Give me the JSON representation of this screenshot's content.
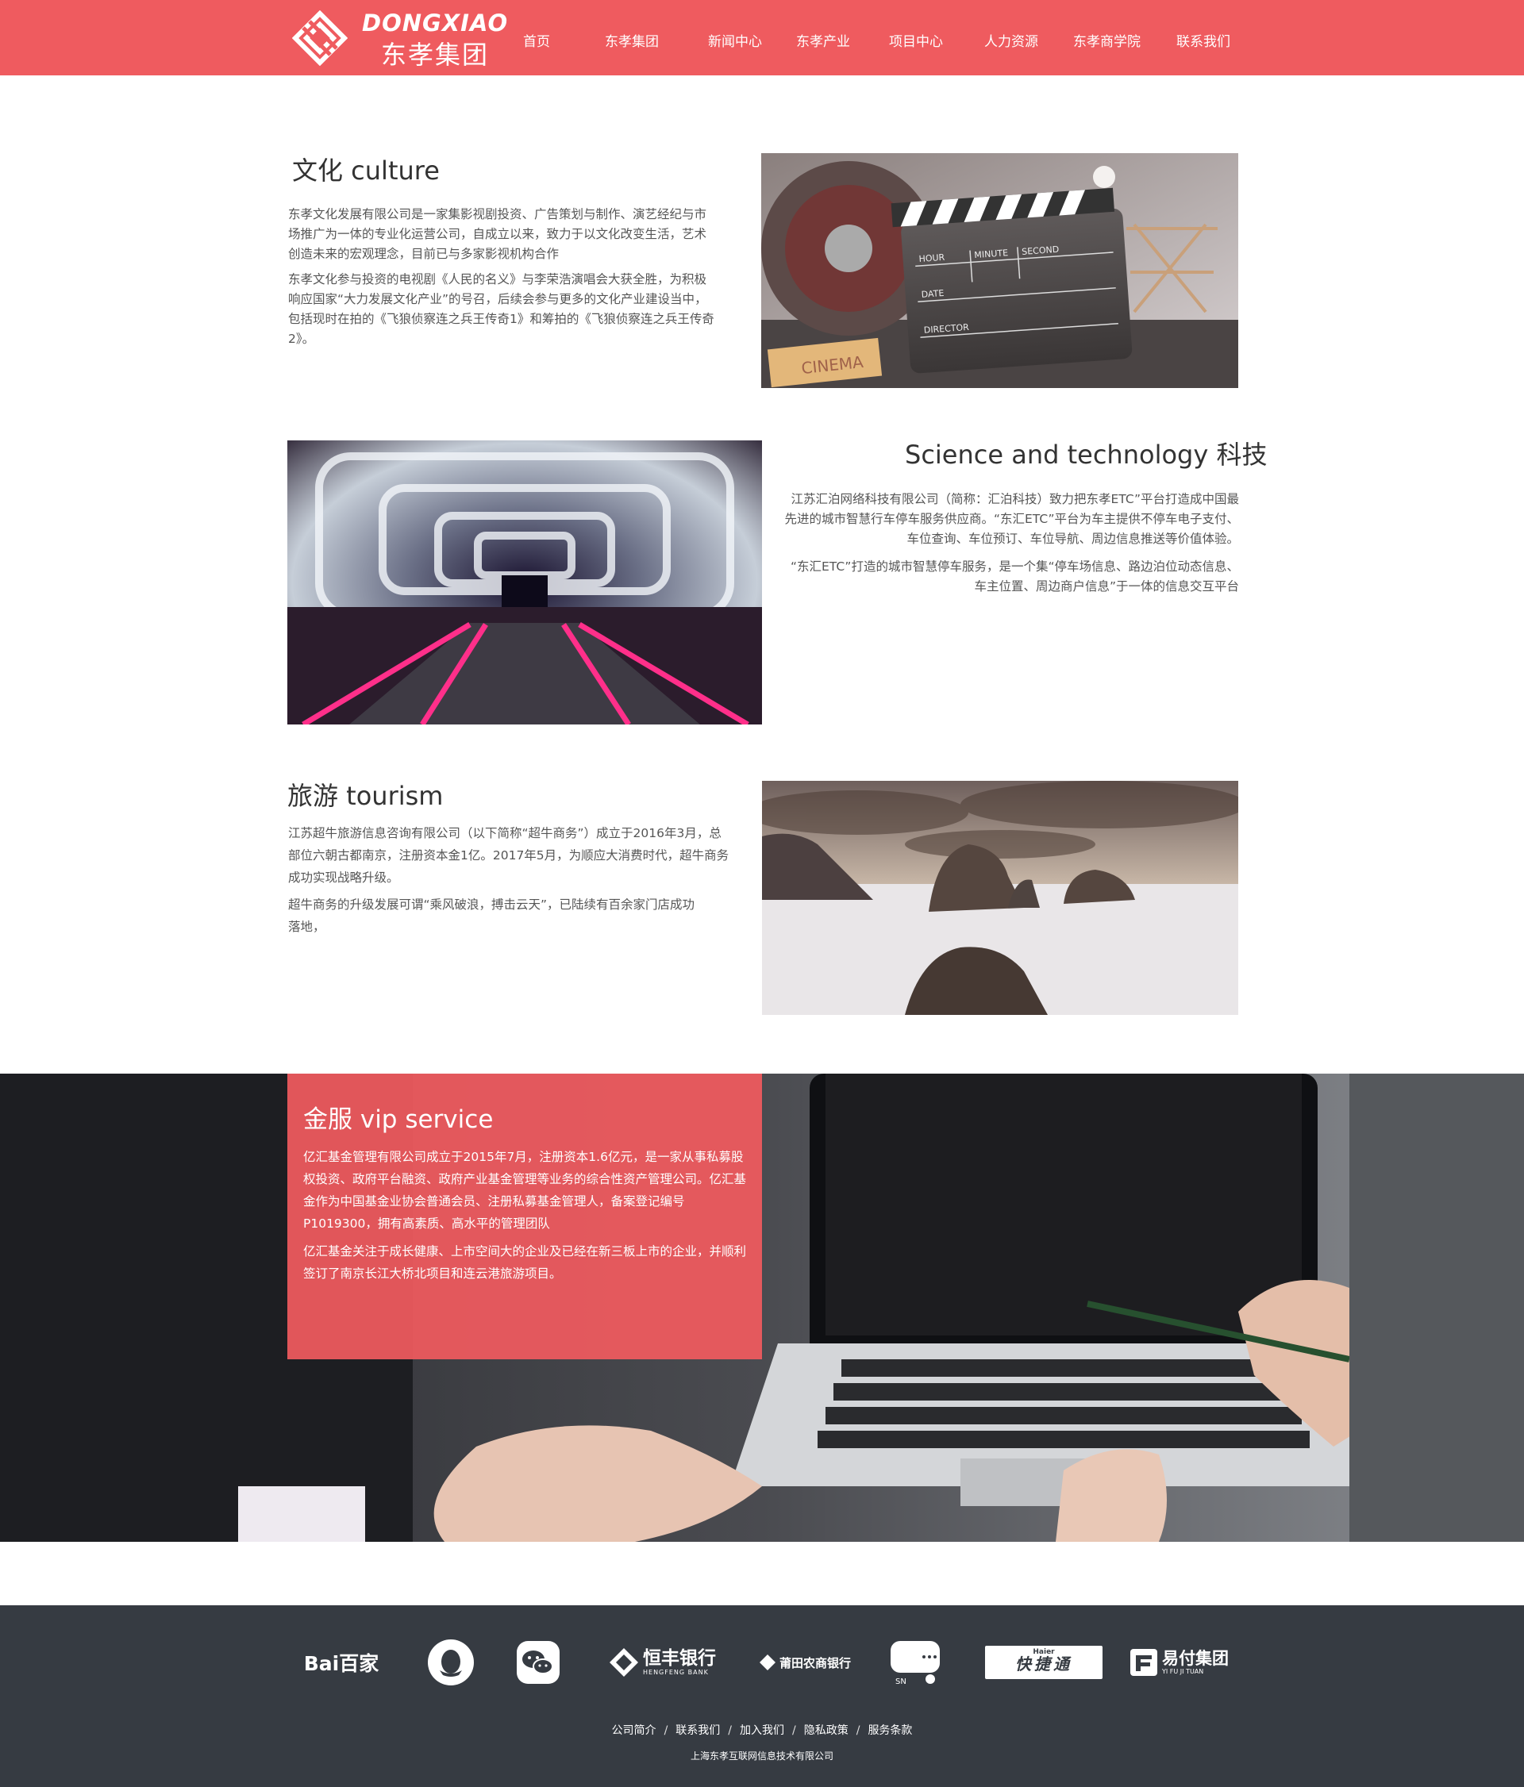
{
  "header": {
    "logo_en": "DONGXIAO",
    "logo_cn": "东孝集团",
    "nav": [
      {
        "label": "首页"
      },
      {
        "label": "东孝集团"
      },
      {
        "label": "新闻中心"
      },
      {
        "label": "东孝产业"
      },
      {
        "label": "项目中心"
      },
      {
        "label": "人力资源"
      },
      {
        "label": "东孝商学院"
      },
      {
        "label": "联系我们"
      }
    ]
  },
  "culture": {
    "title": "文化  culture",
    "p1": " 东孝文化发展有限公司是一家集影视剧投资、广告策划与制作、演艺经纪与市场推广为一体的专业化运营公司，自成立以来，致力于以文化改变生活，艺术创造未来的宏观理念，目前已与多家影视机构合作",
    "p2": "东孝文化参与投资的电视剧《人民的名义》与李荣浩演唱会大获全胜，为积极响应国家“大力发展文化产业”的号召，后续会参与更多的文化产业建设当中，包括现时在拍的《飞狼侦察连之兵王传奇1》和筹拍的《飞狼侦察连之兵王传奇2》。",
    "clapper": {
      "hour": "HOUR",
      "minute": "MINUTE",
      "second": "SECOND",
      "date": "DATE",
      "director": "DIRECTOR",
      "ticket": "CINEMA"
    }
  },
  "tech": {
    "title": "Science and technology  科技",
    "p1": "江苏汇泊网络科技有限公司（简称：汇泊科技）致力把东孝ETC”平台打造成中国最先进的城市智慧行车停车服务供应商。“东汇ETC”平台为车主提供不停车电子支付、车位查询、车位预订、车位导航、周边信息推送等价值体验。",
    "p2": "“东汇ETC”打造的城市智慧停车服务，是一个集“停车场信息、路边泊位动态信息、车主位置、周边商户信息”于一体的信息交互平台"
  },
  "tourism": {
    "title": "旅游  tourism",
    "p1": "江苏超牛旅游信息咨询有限公司（以下简称“超牛商务”）成立于2016年3月，总部位六朝古都南京，注册资本金1亿。2017年5月，为顺应大消费时代，超牛商务成功实现战略升级。",
    "p2": "超牛商务的升级发展可谓“乘风破浪，搏击云天”，已陆续有百余家门店成功落地，"
  },
  "vip": {
    "title": "金服  vip service",
    "p1": "亿汇基金管理有限公司成立于2015年7月，注册资本1.6亿元，是一家从事私募股权投资、政府平台融资、政府产业基金管理等业务的综合性资产管理公司。亿汇基金作为中国基金业协会普通会员、注册私募基金管理人，备案登记编号P1019300，拥有高素质、高水平的管理团队",
    "p2": "亿汇基金关注于成长健康、上市空间大的企业及已经在新三板上市的企业，并顺利签订了南京长江大桥北项目和连云港旅游项目。"
  },
  "footer": {
    "partners": {
      "baidu": "Bai百家",
      "hengfeng_cn": "恒丰银行",
      "hengfeng_en": "HENGFENG BANK",
      "putian": "莆田农商银行",
      "suning": "SN",
      "haier_top": "Haier",
      "haier_main": "快捷通",
      "yifu_cn": "易付集团",
      "yifu_en": "YI FU JI TUAN"
    },
    "links": [
      "公司简介",
      "联系我们",
      "加入我们",
      "隐私政策",
      "服务条款"
    ],
    "copyright": "上海东孝互联网信息技术有限公司"
  },
  "colors": {
    "brand_red": "#ef5b5f",
    "footer_bg": "#363b42"
  }
}
